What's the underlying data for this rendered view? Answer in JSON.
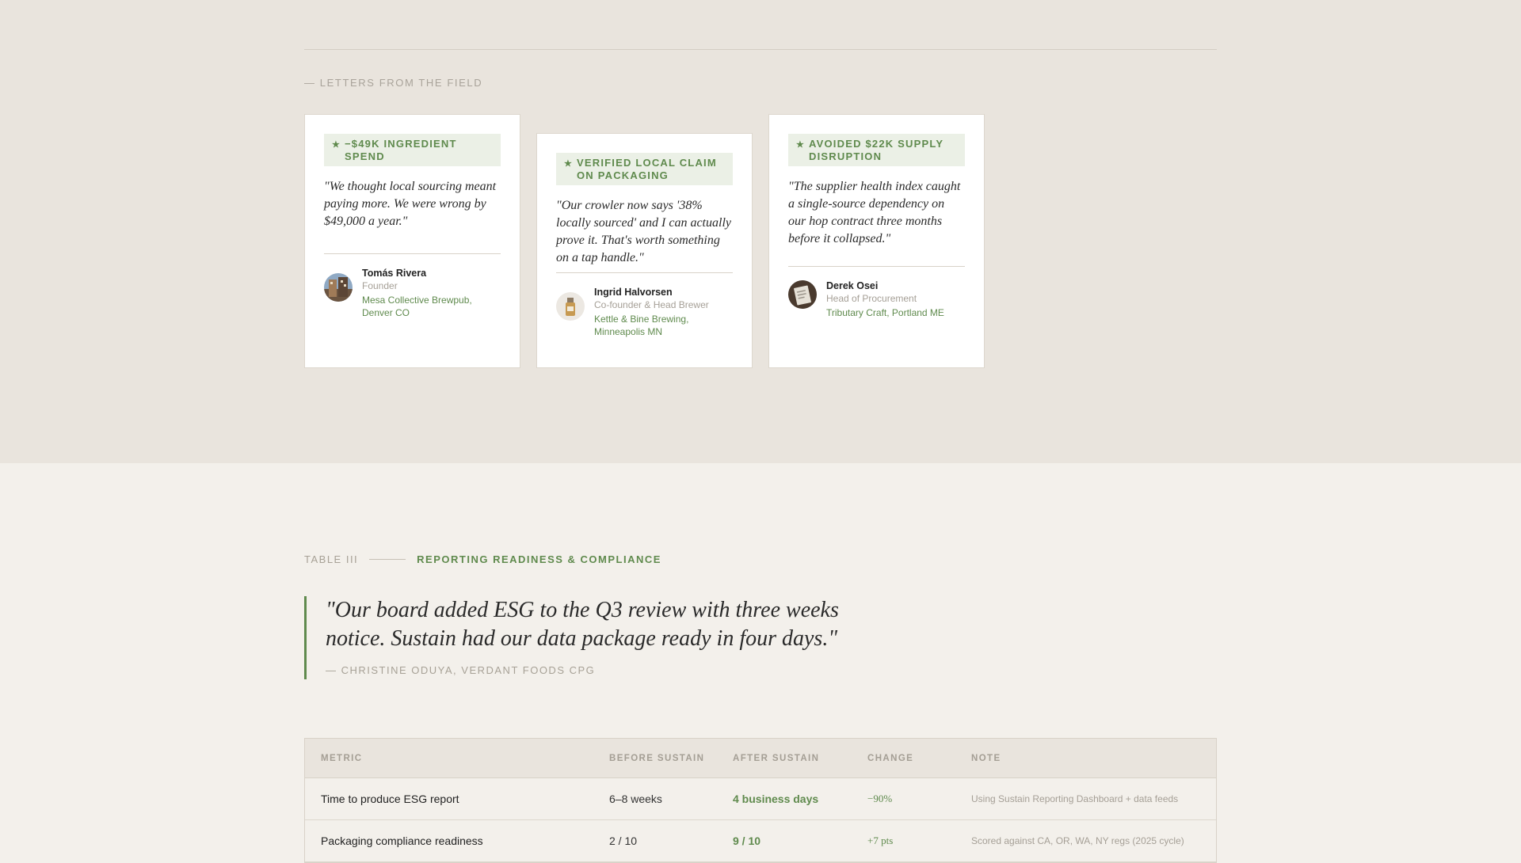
{
  "section_eyebrow": "— LETTERS FROM THE FIELD",
  "testimonials": [
    {
      "badge": "−$49K INGREDIENT SPEND",
      "quote": "\"We thought local sourcing meant paying more. We were wrong by $49,000 a year.\"",
      "name": "Tomás Rivera",
      "role": "Founder",
      "org": "Mesa Collective Brewpub, Denver CO"
    },
    {
      "badge": "VERIFIED LOCAL CLAIM ON PACKAGING",
      "quote": "\"Our crowler now says '38% locally sourced' and I can actually prove it. That's worth something on a tap handle.\"",
      "name": "Ingrid Halvorsen",
      "role": "Co-founder & Head Brewer",
      "org": "Kettle & Bine Brewing, Minneapolis MN"
    },
    {
      "badge": "AVOIDED $22K SUPPLY DISRUPTION",
      "quote": "\"The supplier health index caught a single-source dependency on our hop contract three months before it collapsed.\"",
      "name": "Derek Osei",
      "role": "Head of Procurement",
      "org": "Tributary Craft, Portland ME"
    }
  ],
  "badge_icon": "★",
  "table_section": {
    "number": "TABLE III",
    "title": "REPORTING READINESS & COMPLIANCE"
  },
  "pull_quote": {
    "text": "\"Our board added ESG to the Q3 review with three weeks notice. Sustain had our data package ready in four days.\"",
    "attribution": "— CHRISTINE ODUYA, VERDANT FOODS CPG"
  },
  "table": {
    "headers": [
      "METRIC",
      "BEFORE SUSTAIN",
      "AFTER SUSTAIN",
      "CHANGE",
      "NOTE"
    ],
    "rows": [
      {
        "metric": "Time to produce ESG report",
        "before": "6–8 weeks",
        "after": "4 business days",
        "change": "−90%",
        "note": "Using Sustain Reporting Dashboard + data feeds"
      },
      {
        "metric": "Packaging compliance readiness",
        "before": "2 / 10",
        "after": "9 / 10",
        "change": "+7 pts",
        "note": "Scored against CA, OR, WA, NY regs (2025 cycle)"
      }
    ]
  },
  "colors": {
    "accent_green": "#5f8a4d",
    "top_background": "#e9e4dd",
    "page_background": "#f3f0eb"
  }
}
